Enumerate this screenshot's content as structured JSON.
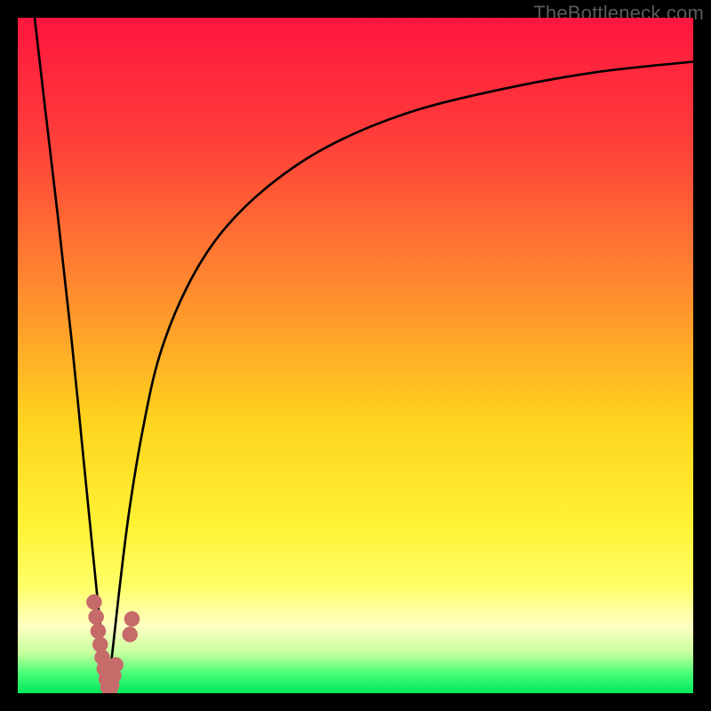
{
  "watermark": "TheBottleneck.com",
  "chart_data": {
    "type": "line",
    "title": "",
    "xlabel": "",
    "ylabel": "",
    "xlim": [
      0,
      100
    ],
    "ylim": [
      0,
      100
    ],
    "gradient_stops": [
      {
        "offset": 0,
        "color": "#ff163f"
      },
      {
        "offset": 18,
        "color": "#ff3e3a"
      },
      {
        "offset": 40,
        "color": "#ff8a2f"
      },
      {
        "offset": 60,
        "color": "#ffd41e"
      },
      {
        "offset": 75,
        "color": "#fff235"
      },
      {
        "offset": 84,
        "color": "#ffff66"
      },
      {
        "offset": 90,
        "color": "#ffffc2"
      },
      {
        "offset": 94,
        "color": "#c8ff9e"
      },
      {
        "offset": 97,
        "color": "#4cff77"
      },
      {
        "offset": 100,
        "color": "#00e85e"
      }
    ],
    "series": [
      {
        "name": "left-curve",
        "x": [
          2.5,
          4,
          6,
          8,
          10,
          11.5,
          12.5,
          13.3
        ],
        "y": [
          100,
          87,
          70,
          52,
          32,
          17,
          7,
          0
        ]
      },
      {
        "name": "right-curve",
        "x": [
          13.3,
          14,
          15,
          16.5,
          18.5,
          21,
          25,
          30,
          37,
          46,
          58,
          72,
          86,
          100
        ],
        "y": [
          0,
          6,
          15,
          27,
          39,
          50,
          60,
          68,
          75,
          81,
          86,
          89.5,
          92,
          93.5
        ]
      }
    ],
    "markers": {
      "name": "data-points",
      "color": "#c76a6a",
      "radius": 1.15,
      "points": [
        {
          "x": 11.3,
          "y": 13.5
        },
        {
          "x": 11.6,
          "y": 11.3
        },
        {
          "x": 11.9,
          "y": 9.2
        },
        {
          "x": 12.2,
          "y": 7.2
        },
        {
          "x": 12.5,
          "y": 5.3
        },
        {
          "x": 12.8,
          "y": 3.6
        },
        {
          "x": 13.1,
          "y": 2.1
        },
        {
          "x": 13.35,
          "y": 0.9
        },
        {
          "x": 13.6,
          "y": 0.3
        },
        {
          "x": 13.9,
          "y": 1.2
        },
        {
          "x": 14.2,
          "y": 2.6
        },
        {
          "x": 14.5,
          "y": 4.2
        },
        {
          "x": 16.6,
          "y": 8.7
        },
        {
          "x": 16.9,
          "y": 11.0
        }
      ]
    }
  }
}
